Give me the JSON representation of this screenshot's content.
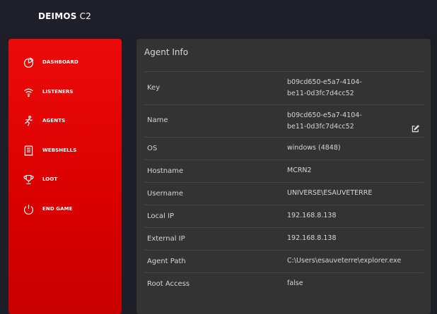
{
  "app": {
    "brand_bold": "DEIMOS",
    "brand_light": " C2"
  },
  "sidebar": {
    "items": [
      {
        "label": "DASHBOARD",
        "icon": "dashboard-icon"
      },
      {
        "label": "LISTENERS",
        "icon": "wifi-icon"
      },
      {
        "label": "AGENTS",
        "icon": "running-person-icon"
      },
      {
        "label": "WEBSHELLS",
        "icon": "document-icon"
      },
      {
        "label": "LOOT",
        "icon": "trophy-icon"
      },
      {
        "label": "END GAME",
        "icon": "power-icon"
      }
    ]
  },
  "agent_info": {
    "title": "Agent Info",
    "rows": [
      {
        "key": "Key",
        "value_line1": "b09cd650-e5a7-4104-",
        "value_line2": "be11-0d3fc7d4cc52"
      },
      {
        "key": "Name",
        "value_line1": "b09cd650-e5a7-4104-",
        "value_line2": "be11-0d3fc7d4cc52",
        "editable": true
      },
      {
        "key": "OS",
        "value": "windows (4848)"
      },
      {
        "key": "Hostname",
        "value": "MCRN2"
      },
      {
        "key": "Username",
        "value": "UNIVERSE\\ESAUVETERRE"
      },
      {
        "key": "Local IP",
        "value": "192.168.8.138"
      },
      {
        "key": "External IP",
        "value": "192.168.8.138"
      },
      {
        "key": "Agent Path",
        "value": "C:\\Users\\esauveterre\\explorer.exe"
      },
      {
        "key": "Root Access",
        "value": "false"
      }
    ]
  }
}
